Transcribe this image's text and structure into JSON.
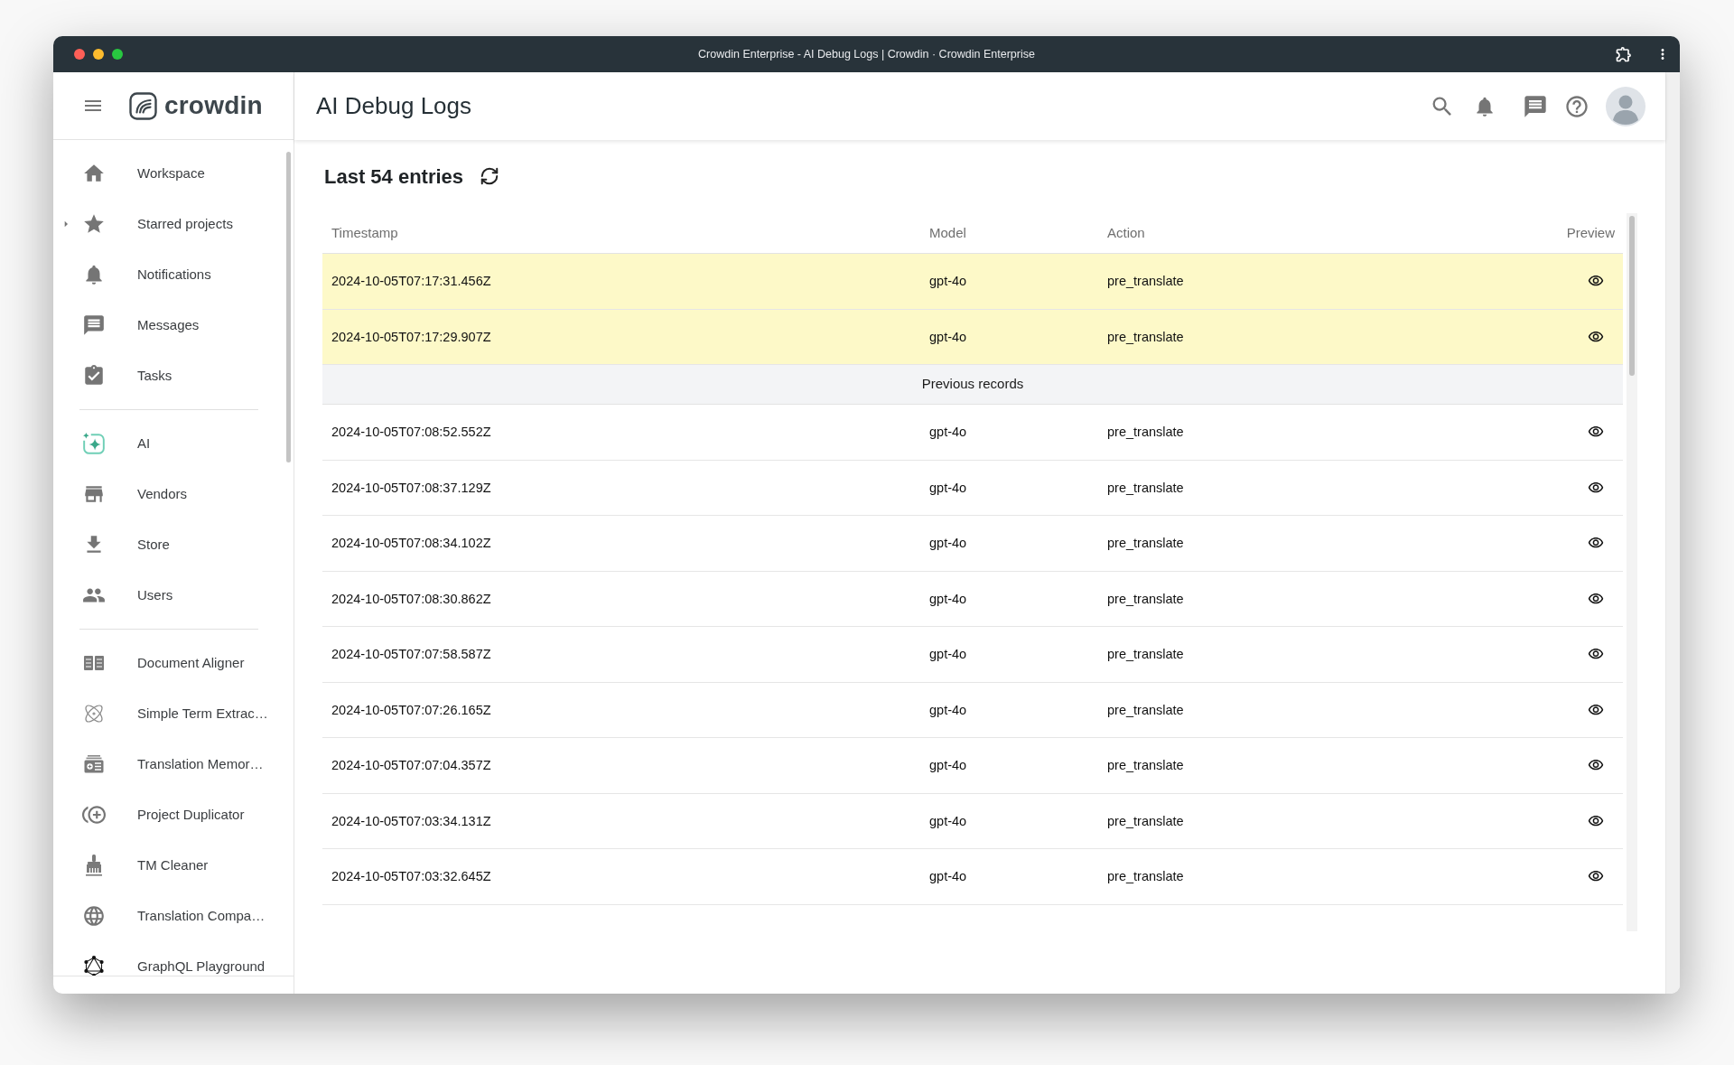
{
  "window": {
    "title": "Crowdin Enterprise - AI Debug Logs | Crowdin · Crowdin Enterprise"
  },
  "header": {
    "logo_text": "crowdin",
    "page_title": "AI Debug Logs"
  },
  "sidebar": {
    "sections": [
      {
        "items": [
          {
            "label": "Workspace"
          },
          {
            "label": "Starred projects",
            "expanded": false
          },
          {
            "label": "Notifications"
          },
          {
            "label": "Messages"
          },
          {
            "label": "Tasks"
          }
        ]
      },
      {
        "items": [
          {
            "label": "AI"
          },
          {
            "label": "Vendors"
          },
          {
            "label": "Store"
          },
          {
            "label": "Users"
          }
        ]
      },
      {
        "items": [
          {
            "label": "Document Aligner"
          },
          {
            "label": "Simple Term Extrac…"
          },
          {
            "label": "Translation Memor…"
          },
          {
            "label": "Project Duplicator"
          },
          {
            "label": "TM Cleaner"
          },
          {
            "label": "Translation Compa…"
          },
          {
            "label": "GraphQL Playground"
          }
        ]
      }
    ]
  },
  "content": {
    "heading": "Last 54 entries",
    "table": {
      "columns": [
        "Timestamp",
        "Model",
        "Action",
        "Preview"
      ],
      "rows": [
        {
          "kind": "entry",
          "highlighted": true,
          "cells": [
            "2024-10-05T07:17:31.456Z",
            "gpt-4o",
            "pre_translate"
          ]
        },
        {
          "kind": "entry",
          "highlighted": true,
          "cells": [
            "2024-10-05T07:17:29.907Z",
            "gpt-4o",
            "pre_translate"
          ]
        },
        {
          "kind": "separator",
          "label": "Previous records"
        },
        {
          "kind": "entry",
          "highlighted": false,
          "cells": [
            "2024-10-05T07:08:52.552Z",
            "gpt-4o",
            "pre_translate"
          ]
        },
        {
          "kind": "entry",
          "highlighted": false,
          "cells": [
            "2024-10-05T07:08:37.129Z",
            "gpt-4o",
            "pre_translate"
          ]
        },
        {
          "kind": "entry",
          "highlighted": false,
          "cells": [
            "2024-10-05T07:08:34.102Z",
            "gpt-4o",
            "pre_translate"
          ]
        },
        {
          "kind": "entry",
          "highlighted": false,
          "cells": [
            "2024-10-05T07:08:30.862Z",
            "gpt-4o",
            "pre_translate"
          ]
        },
        {
          "kind": "entry",
          "highlighted": false,
          "cells": [
            "2024-10-05T07:07:58.587Z",
            "gpt-4o",
            "pre_translate"
          ]
        },
        {
          "kind": "entry",
          "highlighted": false,
          "cells": [
            "2024-10-05T07:07:26.165Z",
            "gpt-4o",
            "pre_translate"
          ]
        },
        {
          "kind": "entry",
          "highlighted": false,
          "cells": [
            "2024-10-05T07:07:04.357Z",
            "gpt-4o",
            "pre_translate"
          ]
        },
        {
          "kind": "entry",
          "highlighted": false,
          "cells": [
            "2024-10-05T07:03:34.131Z",
            "gpt-4o",
            "pre_translate"
          ]
        },
        {
          "kind": "entry",
          "highlighted": false,
          "cells": [
            "2024-10-05T07:03:32.645Z",
            "gpt-4o",
            "pre_translate"
          ]
        }
      ]
    }
  }
}
